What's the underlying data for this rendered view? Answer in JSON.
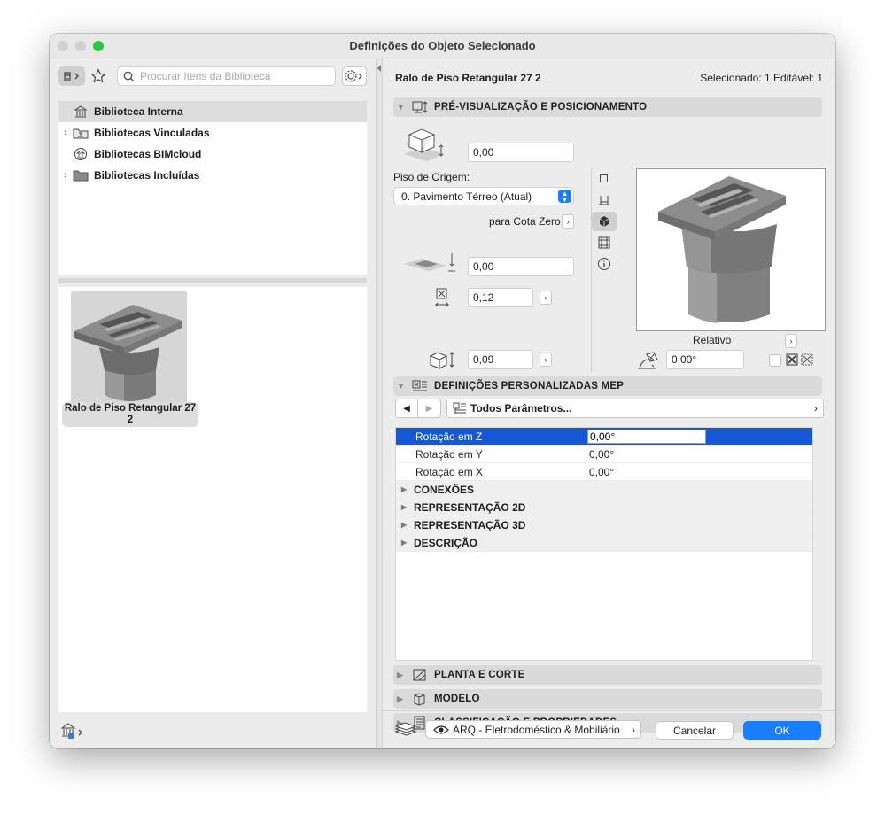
{
  "window": {
    "title": "Definições do Objeto Selecionado"
  },
  "library": {
    "search_placeholder": "Procurar Itens da Biblioteca",
    "tree": [
      {
        "label": "Biblioteca Interna",
        "icon": "library-building-icon",
        "has_children": false,
        "selected": true
      },
      {
        "label": "Bibliotecas Vinculadas",
        "icon": "linked-folder-icon",
        "has_children": true,
        "selected": false
      },
      {
        "label": "Bibliotecas BIMcloud",
        "icon": "bimcloud-icon",
        "has_children": false,
        "selected": false
      },
      {
        "label": "Bibliotecas Incluídas",
        "icon": "folder-icon",
        "has_children": true,
        "selected": false
      }
    ],
    "selected_item": {
      "label_line1": "Ralo de Piso Retangular 27",
      "label_line2": "2"
    }
  },
  "object": {
    "name": "Ralo de Piso Retangular 27 2",
    "selection_info": "Selecionado: 1 Editável: 1"
  },
  "preview_section": {
    "title": "PRÉ-VISUALIZAÇÃO E POSICIONAMENTO",
    "elevation_value": "0,00",
    "home_story_label": "Piso de Origem:",
    "home_story_value": "0. Pavimento Térreo (Atual)",
    "reference_label": "para Cota Zero",
    "sea_level_value": "0,00",
    "width_value": "0,12",
    "height_value": "0,09",
    "preview_mode_label": "Relativo",
    "rotation_value": "0,00°"
  },
  "mep_section": {
    "title": "DEFINIÇÕES PERSONALIZADAS MEP",
    "param_filter": "Todos Parâmetros...",
    "params": [
      {
        "name": "Rotação em Z",
        "value": "0,00°",
        "selected": true
      },
      {
        "name": "Rotação em Y",
        "value": "0,00°",
        "selected": false
      },
      {
        "name": "Rotação em X",
        "value": "0,00°",
        "selected": false
      }
    ],
    "groups": [
      "CONEXÕES",
      "REPRESENTAÇÃO 2D",
      "REPRESENTAÇÃO 3D",
      "DESCRIÇÃO"
    ]
  },
  "collapsed_sections": [
    {
      "title": "PLANTA E CORTE",
      "icon": "floor-plan-icon"
    },
    {
      "title": "MODELO",
      "icon": "model-cube-icon"
    },
    {
      "title": "CLASSIFICAÇÃO E PROPRIEDADES",
      "icon": "document-list-icon"
    }
  ],
  "footer": {
    "layer_value": "ARQ - Eletrodoméstico & Mobiliário",
    "cancel_label": "Cancelar",
    "ok_label": "OK"
  },
  "colors": {
    "accent": "#1a7cff",
    "selection": "#1558d6",
    "zoom_button": "#2dc440"
  }
}
